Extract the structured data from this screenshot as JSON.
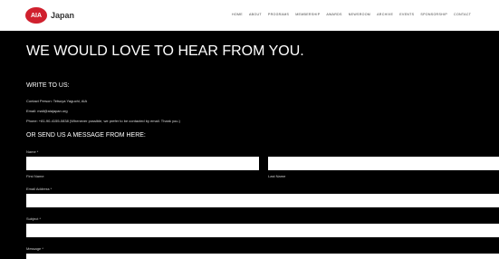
{
  "header": {
    "logo_badge": "AIA",
    "logo_text": "Japan",
    "nav": [
      "HOME",
      "ABOUT",
      "PROGRAMS",
      "MEMBERSHIP",
      "AWARDS",
      "NEWSROOM",
      "ARCHIVE",
      "EVENTS",
      "SPONSORSHIP",
      "CONTACT"
    ]
  },
  "main": {
    "heading": "WE WOULD LOVE TO HEAR FROM YOU.",
    "write_title": "WRITE TO US:",
    "contact_person": "Contact Person: Tetsuya Yaguchi, AIA",
    "email": "Email: mail@aiajapan.org",
    "phone": "Phone: +81-90-4155-0838 (Whenever possible, we prefer to be contacted by email. Thank you.)",
    "form_title": "OR SEND US A MESSAGE FROM HERE:"
  },
  "form": {
    "name_label": "Name *",
    "first_name_label": "First Name",
    "last_name_label": "Last Name",
    "email_label": "Email Address *",
    "subject_label": "Subject *",
    "message_label": "Message *",
    "first_name_value": "",
    "last_name_value": "",
    "email_value": "",
    "subject_value": "",
    "message_value": ""
  },
  "colors": {
    "brand_red": "#d0202e",
    "background": "#000000"
  }
}
